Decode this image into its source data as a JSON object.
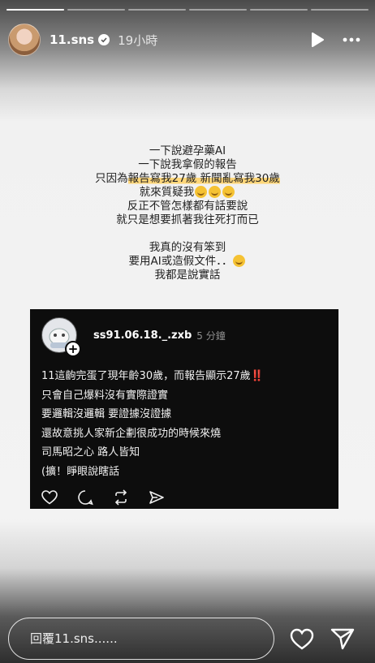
{
  "progress": {
    "segments": 6,
    "current_index": 0,
    "current_fill": 1
  },
  "header": {
    "username": "11.sns",
    "time_ago": "19小時"
  },
  "caption": {
    "lines": [
      "一下說避孕藥AI",
      "一下說我拿假的報告",
      "只因為報告寫我27歲  新聞亂寫我30歲",
      "就來質疑我",
      "反正不管怎樣都有話要說",
      "就只是想要抓著我往死打而已",
      "",
      "我真的沒有笨到",
      "要用AI或造假文件．．",
      "我都是說實話"
    ],
    "line3_prefix": "只因為",
    "line3_highlight": "報告寫我27歲  新聞亂寫我30歲",
    "line4_text": "就來質疑我",
    "line9_text": "要用AI或造假文件．．"
  },
  "post": {
    "username": "ss91.06.18._.zxb",
    "time": "5 分鐘",
    "line1": "11這齣完蛋了現年齡30歲，而報告顯示27歲",
    "line1_mark": "‼️",
    "line2": "只會自己爆料沒有實際證實",
    "line3": "要邏輯沒邏輯 要證據沒證據",
    "line4": "還故意挑人家新企劃很成功的時候來燒",
    "line5": "司馬昭之心 路人皆知",
    "line6": "(擴！睜眼說瞎話"
  },
  "reply": {
    "placeholder": "回覆11.sns......"
  },
  "colors": {
    "highlight": "#ffd77a",
    "card_bg": "#0d0d0d",
    "alert_red": "#e0342a"
  }
}
